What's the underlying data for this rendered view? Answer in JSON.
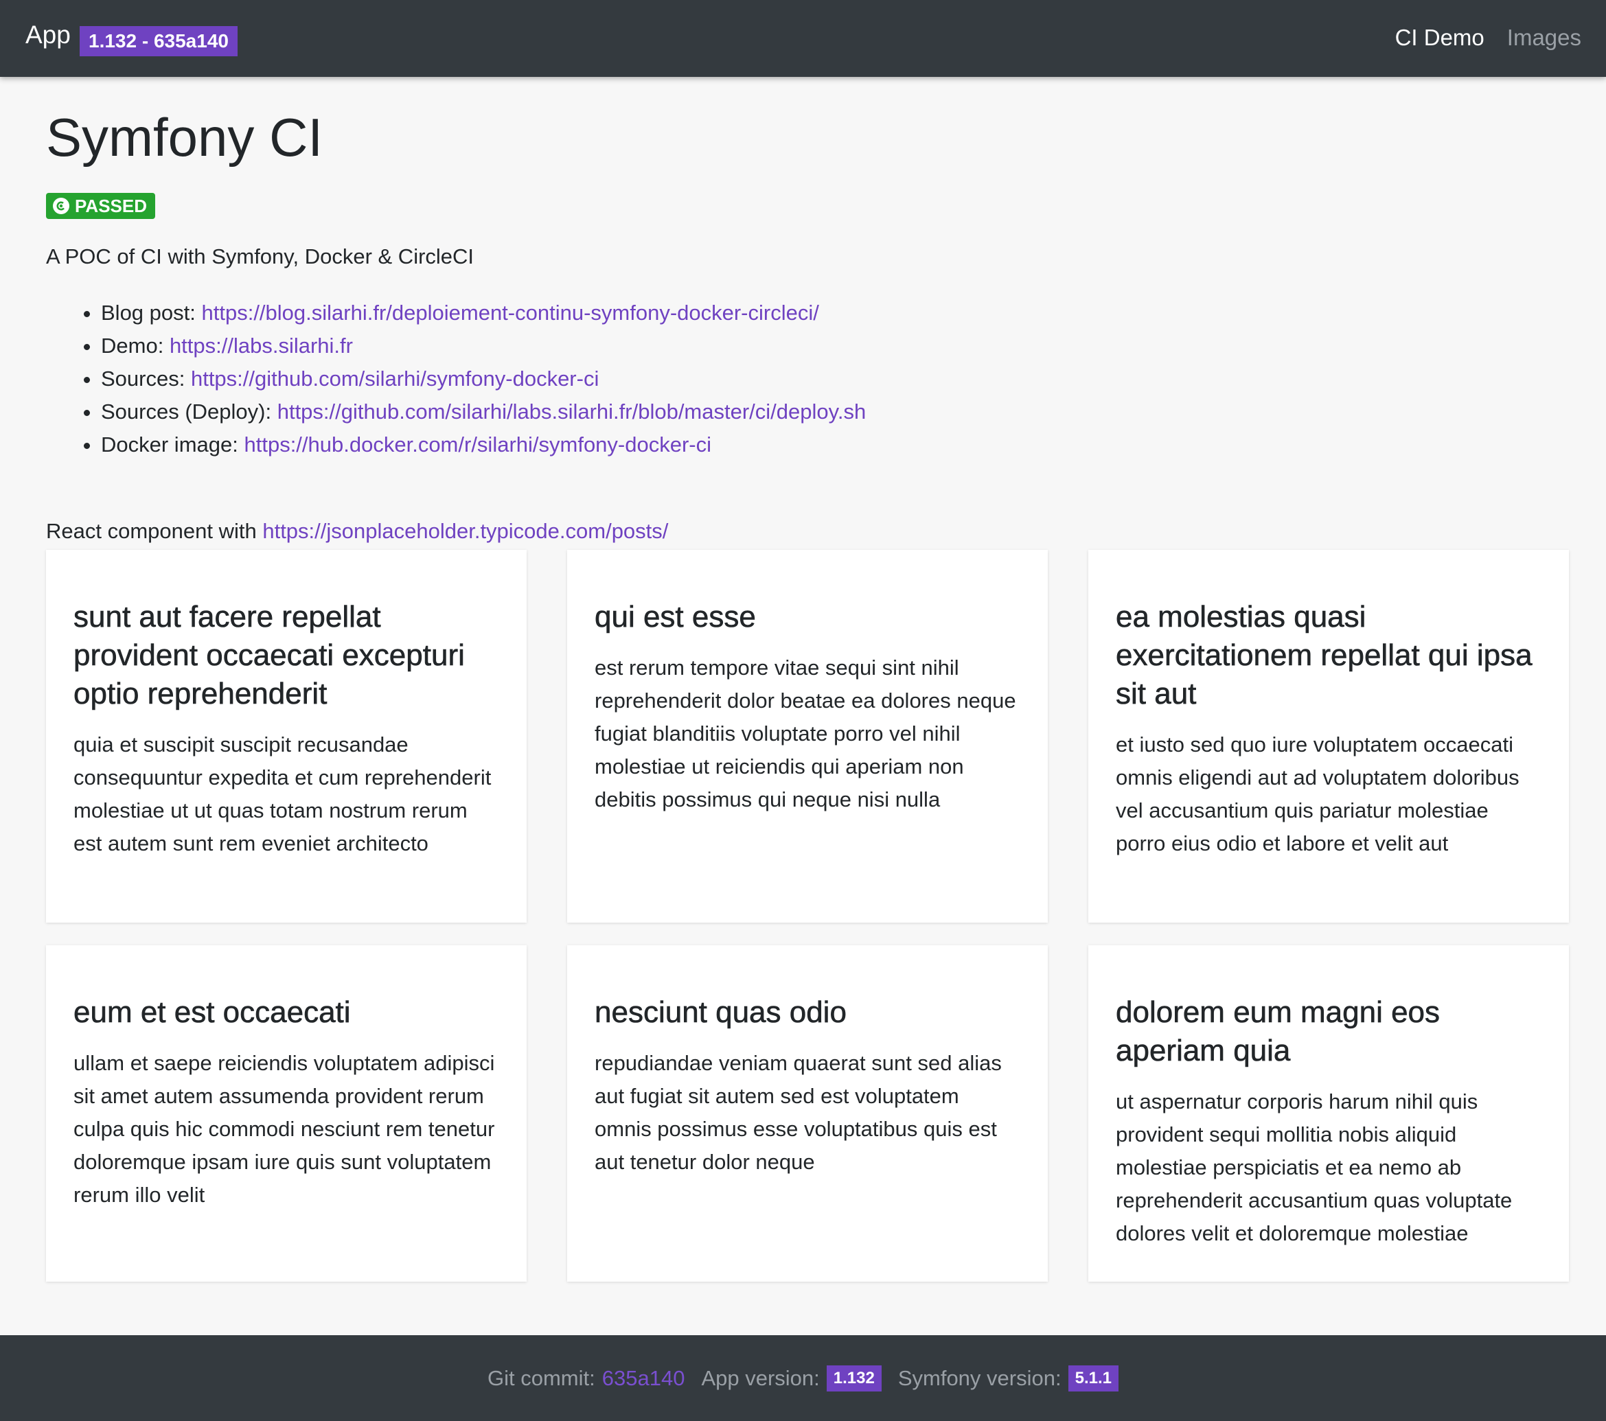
{
  "navbar": {
    "brand": "App",
    "version_badge": "1.132 - 635a140",
    "links": [
      {
        "label": "CI Demo"
      },
      {
        "label": "Images"
      }
    ]
  },
  "page": {
    "title": "Symfony CI",
    "status_badge": "PASSED",
    "description": "A POC of CI with Symfony, Docker & CircleCI",
    "links": [
      {
        "label": "Blog post:",
        "url": "https://blog.silarhi.fr/deploiement-continu-symfony-docker-circleci/"
      },
      {
        "label": "Demo:",
        "url": "https://labs.silarhi.fr"
      },
      {
        "label": "Sources:",
        "url": "https://github.com/silarhi/symfony-docker-ci"
      },
      {
        "label": "Sources (Deploy):",
        "url": "https://github.com/silarhi/labs.silarhi.fr/blob/master/ci/deploy.sh"
      },
      {
        "label": "Docker image:",
        "url": "https://hub.docker.com/r/silarhi/symfony-docker-ci"
      }
    ],
    "react_note": "React component with",
    "react_link": "https://jsonplaceholder.typicode.com/posts/"
  },
  "posts": [
    {
      "title": "sunt aut facere repellat provident occaecati excepturi optio reprehenderit",
      "body": "quia et suscipit suscipit recusandae consequuntur expedita et cum reprehenderit molestiae ut ut quas totam nostrum rerum est autem sunt rem eveniet architecto"
    },
    {
      "title": "qui est esse",
      "body": "est rerum tempore vitae sequi sint nihil reprehenderit dolor beatae ea dolores neque fugiat blanditiis voluptate porro vel nihil molestiae ut reiciendis qui aperiam non debitis possimus qui neque nisi nulla"
    },
    {
      "title": "ea molestias quasi exercitationem repellat qui ipsa sit aut",
      "body": "et iusto sed quo iure voluptatem occaecati omnis eligendi aut ad voluptatem doloribus vel accusantium quis pariatur molestiae porro eius odio et labore et velit aut"
    },
    {
      "title": "eum et est occaecati",
      "body": "ullam et saepe reiciendis voluptatem adipisci sit amet autem assumenda provident rerum culpa quis hic commodi nesciunt rem tenetur doloremque ipsam iure quis sunt voluptatem rerum illo velit"
    },
    {
      "title": "nesciunt quas odio",
      "body": "repudiandae veniam quaerat sunt sed alias aut fugiat sit autem sed est voluptatem omnis possimus esse voluptatibus quis est aut tenetur dolor neque"
    },
    {
      "title": "dolorem eum magni eos aperiam quia",
      "body": "ut aspernatur corporis harum nihil quis provident sequi mollitia nobis aliquid molestiae perspiciatis et ea nemo ab reprehenderit accusantium quas voluptate dolores velit et doloremque molestiae"
    }
  ],
  "footer": {
    "commit_label": "Git commit:",
    "commit_value": "635a140",
    "app_version_label": "App version:",
    "app_version_value": "1.132",
    "symfony_version_label": "Symfony version:",
    "symfony_version_value": "5.1.1"
  },
  "colors": {
    "navbar_bg": "#343a3f",
    "accent": "#6f42c1",
    "success": "#25a32f",
    "page_bg": "#f7f7f7"
  }
}
